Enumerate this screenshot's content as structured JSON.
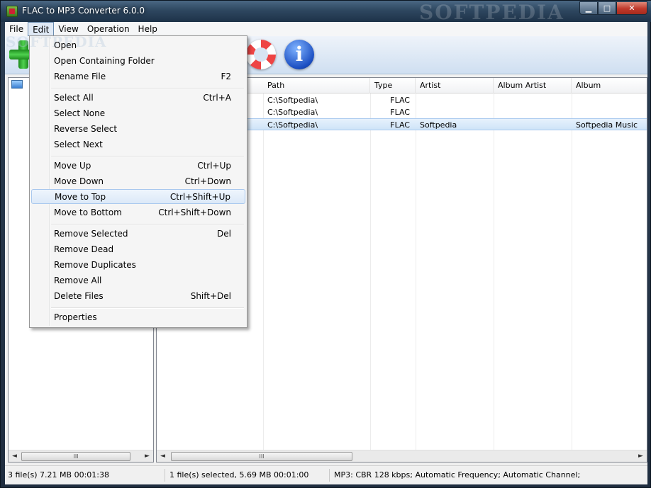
{
  "window": {
    "title": "FLAC to MP3 Converter 6.0.0",
    "watermark": "SOFTPEDIA",
    "controls": {
      "minimize": "▁",
      "maximize": "□",
      "close": "✕"
    }
  },
  "menubar": {
    "items": [
      "File",
      "Edit",
      "View",
      "Operation",
      "Help"
    ],
    "open": "Edit"
  },
  "edit_menu": {
    "items": [
      {
        "label": "Open",
        "shortcut": ""
      },
      {
        "label": "Open Containing Folder",
        "shortcut": ""
      },
      {
        "label": "Rename File",
        "shortcut": "F2"
      },
      {
        "label": "Select All",
        "shortcut": "Ctrl+A"
      },
      {
        "label": "Select None",
        "shortcut": ""
      },
      {
        "label": "Reverse Select",
        "shortcut": ""
      },
      {
        "label": "Select Next",
        "shortcut": ""
      },
      {
        "label": "Move Up",
        "shortcut": "Ctrl+Up"
      },
      {
        "label": "Move Down",
        "shortcut": "Ctrl+Down"
      },
      {
        "label": "Move to Top",
        "shortcut": "Ctrl+Shift+Up"
      },
      {
        "label": "Move to Bottom",
        "shortcut": "Ctrl+Shift+Down"
      },
      {
        "label": "Remove Selected",
        "shortcut": "Del"
      },
      {
        "label": "Remove Dead",
        "shortcut": ""
      },
      {
        "label": "Remove Duplicates",
        "shortcut": ""
      },
      {
        "label": "Remove All",
        "shortcut": ""
      },
      {
        "label": "Delete Files",
        "shortcut": "Shift+Del"
      },
      {
        "label": "Properties",
        "shortcut": ""
      }
    ],
    "highlighted": "Move to Top"
  },
  "toolbar": {
    "icons": [
      "add-icon",
      "help-lifebuoy-icon",
      "info-icon"
    ],
    "info_glyph": "i"
  },
  "file_list": {
    "columns": [
      "Path",
      "Type",
      "Artist",
      "Album Artist",
      "Album"
    ],
    "rows": [
      {
        "path": "C:\\Softpedia\\",
        "type": "FLAC",
        "artist": "",
        "album_artist": "",
        "album": "",
        "selected": false
      },
      {
        "path": "C:\\Softpedia\\",
        "type": "FLAC",
        "artist": "",
        "album_artist": "",
        "album": "",
        "selected": false
      },
      {
        "path": "C:\\Softpedia\\",
        "type": "FLAC",
        "artist": "Softpedia",
        "album_artist": "",
        "album": "Softpedia Music",
        "selected": true
      }
    ]
  },
  "scrollbars": {
    "thumb_glyph": "III",
    "left": "◄",
    "right": "►"
  },
  "status": {
    "totals": "3 file(s)    7.21 MB    00:01:38",
    "selection": "1 file(s) selected, 5.69 MB    00:01:00",
    "format": "MP3:  CBR 128 kbps; Automatic Frequency; Automatic Channel;"
  }
}
